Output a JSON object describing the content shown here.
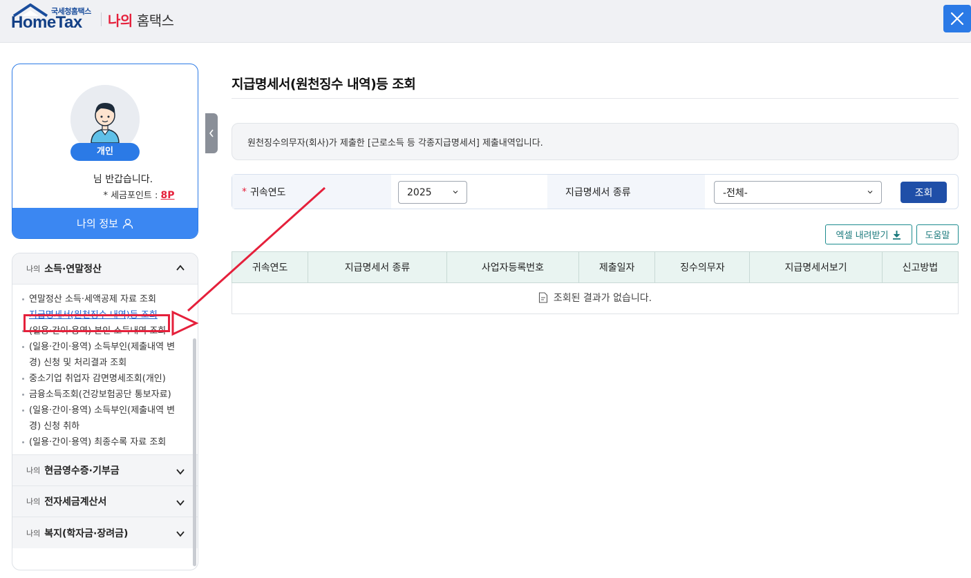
{
  "header": {
    "logo_small": "국세청홈택스",
    "logo_main": "HomeTax",
    "title_highlight": "나의",
    "title_rest": "홈택스",
    "close_icon": "close-icon"
  },
  "profile": {
    "badge": "개인",
    "greeting": "님 반갑습니다.",
    "points_label": "세금포인트 :",
    "points_star": "*",
    "points_value": "8P",
    "myinfo_label": "나의 정보"
  },
  "menu": {
    "sections": [
      {
        "prefix": "나의",
        "title": "소득·연말정산",
        "expanded": true
      },
      {
        "prefix": "나의",
        "title": "현금영수증·기부금",
        "expanded": false
      },
      {
        "prefix": "나의",
        "title": "전자세금계산서",
        "expanded": false
      },
      {
        "prefix": "나의",
        "title": "복지(학자금·장려금)",
        "expanded": false
      }
    ],
    "items": [
      "연말정산 소득·세액공제 자료 조회",
      "지급명세서(원천징수 내역)등 조회",
      "(일용·간이·용역) 본인 소득내역 조회",
      "(일용·간이·용역) 소득부인(제출내역 변경) 신청 및 처리결과 조회",
      "중소기업 취업자 감면명세조회(개인)",
      "금융소득조회(건강보험공단 통보자료)",
      "(일용·간이·용역) 소득부인(제출내역 변경) 신청 취하",
      "(일용·간이·용역) 최종수록 자료 조회"
    ],
    "active_index": 1
  },
  "main": {
    "title": "지급명세서(원천징수 내역)등 조회",
    "notice": "원천징수의무자(회사)가 제출한 [근로소득 등 각종지급명세서] 제출내역입니다.",
    "search": {
      "required_mark": "*",
      "year_label": "귀속연도",
      "year_value": "2025",
      "type_label": "지급명세서 종류",
      "type_value": "-전체-",
      "submit": "조회"
    },
    "excel_button": "엑셀 내려받기",
    "help_button": "도움말",
    "table": {
      "columns": [
        "귀속연도",
        "지급명세서 종류",
        "사업자등록번호",
        "제출일자",
        "징수의무자",
        "지급명세서보기",
        "신고방법"
      ],
      "empty_message": "조회된 결과가 없습니다."
    }
  },
  "colors": {
    "primary": "#2b7ae6",
    "navy": "#1f4fa8",
    "teal": "#1b8b8e",
    "annotation_red": "#e5203b"
  }
}
